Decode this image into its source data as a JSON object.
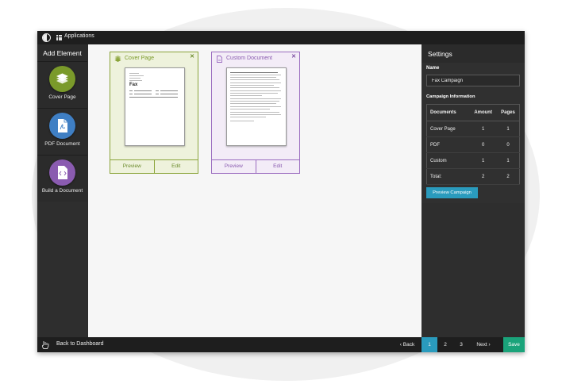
{
  "topbar": {
    "apps_label": "Applications"
  },
  "sidebar": {
    "title": "Add Element",
    "items": [
      {
        "label": "Cover Page",
        "color": "#7a9a2a",
        "icon": "stack-icon"
      },
      {
        "label": "PDF Document",
        "color": "#3f7fc4",
        "icon": "pdf-icon"
      },
      {
        "label": "Build a Document",
        "color": "#8a5bb0",
        "icon": "code-doc-icon"
      }
    ]
  },
  "cards": [
    {
      "title": "Cover Page",
      "color": "#8aa43a",
      "bg": "#eef2dc",
      "close": "✕",
      "thumb_heading": "Fax",
      "preview": "Preview",
      "edit": "Edit"
    },
    {
      "title": "Custom Document",
      "color": "#9a6bbf",
      "bg": "#f3ecf7",
      "close": "✕",
      "preview": "Preview",
      "edit": "Edit"
    }
  ],
  "settings": {
    "title": "Settings",
    "name_label": "Name",
    "name_value": "Fax Campaign",
    "info_label": "Campaign Information",
    "table": {
      "headers": [
        "Documents",
        "Amount",
        "Pages"
      ],
      "rows": [
        [
          "Cover Page",
          "1",
          "1"
        ],
        [
          "PDF",
          "0",
          "0"
        ],
        [
          "Custom",
          "1",
          "1"
        ],
        [
          "Total:",
          "2",
          "2"
        ]
      ]
    },
    "preview_button": "Preview Campaign"
  },
  "bottombar": {
    "back_to_dashboard": "Back to Dashboard",
    "back": "‹  Back",
    "pages": [
      "1",
      "2",
      "3"
    ],
    "active_page": "1",
    "next": "Next  ›",
    "save": "Save"
  },
  "colors": {
    "accent": "#2a9bbd",
    "save": "#1aa37a"
  }
}
